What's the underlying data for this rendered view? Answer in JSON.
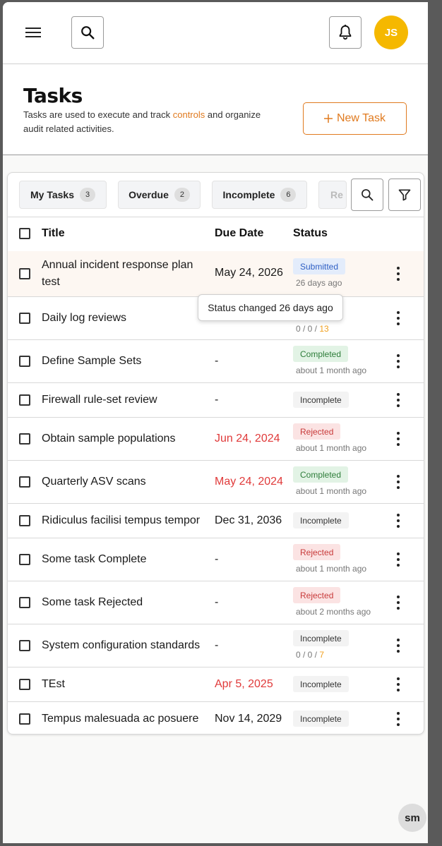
{
  "header": {
    "menu_icon": "hamburger-icon",
    "search_icon": "search-icon",
    "bell_icon": "bell-icon",
    "avatar_initials": "JS",
    "avatar_color": "#f5b800"
  },
  "page": {
    "title": "Tasks",
    "desc_before": "Tasks are used to execute and track ",
    "desc_link": "controls",
    "desc_after": " and organize audit related activities.",
    "new_task_label": "New Task",
    "accent_color": "#e07a1f"
  },
  "tabs": [
    {
      "label": "My Tasks",
      "count": "3"
    },
    {
      "label": "Overdue",
      "count": "2"
    },
    {
      "label": "Incomplete",
      "count": "6"
    },
    {
      "label": "Re",
      "count": ""
    }
  ],
  "table": {
    "columns": [
      "Title",
      "Due Date",
      "Status"
    ],
    "rows": [
      {
        "title": "Annual incident response plan test",
        "due": "May 24, 2026",
        "status": "Submitted",
        "sub": "26 days ago"
      },
      {
        "title": "Daily log reviews",
        "due": "",
        "status": "",
        "sub_a": "0 / 0 / ",
        "sub_b": "13"
      },
      {
        "title": "Define Sample Sets",
        "due": "-",
        "status": "Completed",
        "sub": "about 1 month ago"
      },
      {
        "title": "Firewall rule-set review",
        "due": "-",
        "status": "Incomplete",
        "sub": ""
      },
      {
        "title": "Obtain sample populations",
        "due": "Jun 24, 2024",
        "status": "Rejected",
        "sub": "about 1 month ago"
      },
      {
        "title": "Quarterly ASV scans",
        "due": "May 24, 2024",
        "status": "Completed",
        "sub": "about 1 month ago"
      },
      {
        "title": "Ridiculus facilisi tempus tempor",
        "due": "Dec 31, 2036",
        "status": "Incomplete",
        "sub": ""
      },
      {
        "title": "Some task Complete",
        "due": "-",
        "status": "Rejected",
        "sub": "about 1 month ago"
      },
      {
        "title": "Some task Rejected",
        "due": "-",
        "status": "Rejected",
        "sub": "about 2 months ago"
      },
      {
        "title": "System configuration standards",
        "due": "-",
        "status": "Incomplete",
        "sub_a": "0 / 0 / ",
        "sub_b": "7"
      },
      {
        "title": "TEst",
        "due": "Apr 5, 2025",
        "status": "Incomplete",
        "sub": ""
      },
      {
        "title": "Tempus malesuada ac posuere",
        "due": "Nov 14, 2029",
        "status": "Incomplete",
        "sub": ""
      }
    ]
  },
  "tooltip": "Status changed 26 days ago",
  "footer_badge": "sm",
  "colors": {
    "submitted": "#2f5fc4",
    "completed": "#2e7d3a",
    "rejected": "#c83a3a",
    "overdue_date": "#e03a3a"
  }
}
